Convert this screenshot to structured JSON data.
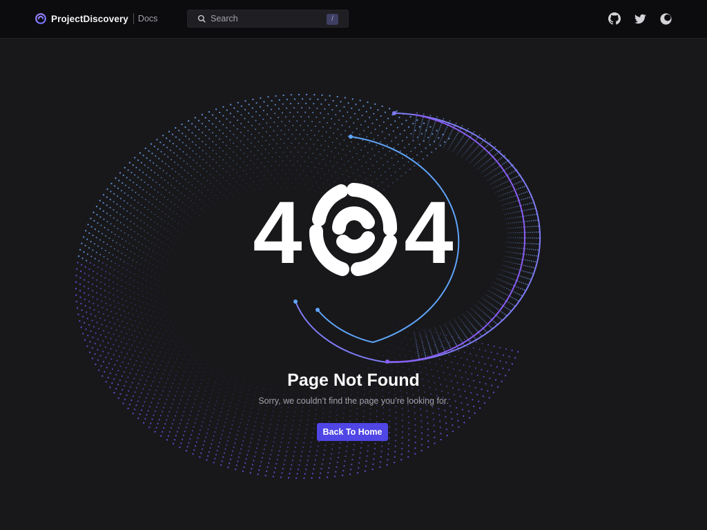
{
  "header": {
    "brand_name": "ProjectDiscovery",
    "section": "Docs",
    "search": {
      "placeholder": "Search",
      "shortcut": "/"
    },
    "icons": [
      "github-icon",
      "twitter-icon",
      "theme-toggle-icon"
    ]
  },
  "error": {
    "code": "404",
    "title": "Page Not Found",
    "message": "Sorry, we couldn’t find the page you’re looking for.",
    "button_label": "Back To Home"
  },
  "colors": {
    "background": "#18181b",
    "header_background": "#0c0c0e",
    "accent": "#4f46e5",
    "arc_blue": "#60a5fa",
    "arc_purple": "#8b5cf6"
  }
}
